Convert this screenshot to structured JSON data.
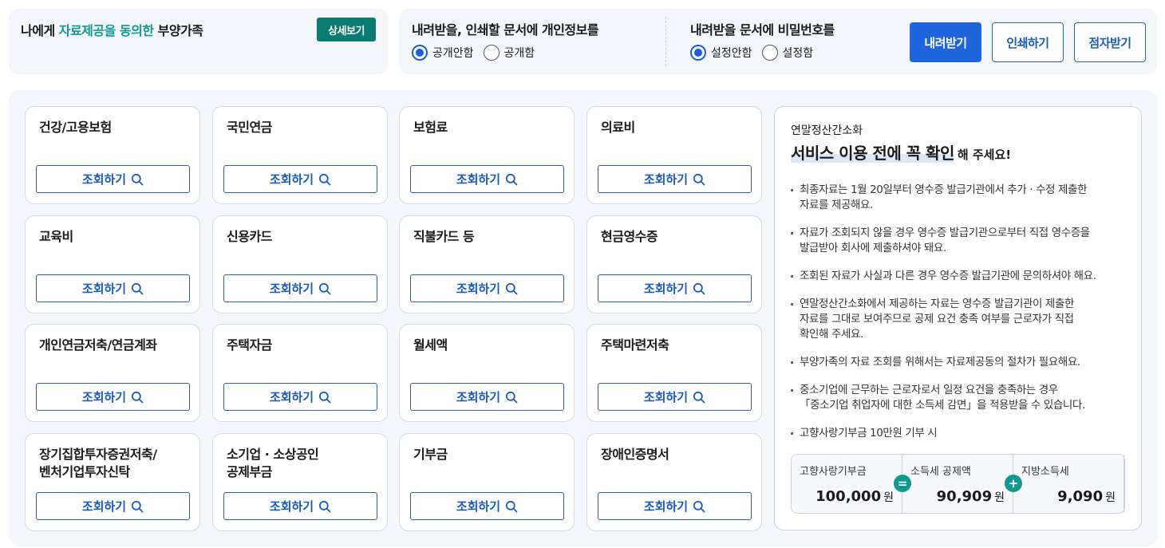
{
  "consent_panel": {
    "title_prefix": "나에게 ",
    "title_highlight": "자료제공을 동의한",
    "title_suffix": " 부양가족",
    "detail_button": "상세보기"
  },
  "options": {
    "personal_info": {
      "label": "내려받을, 인쇄할 문서에 개인정보를",
      "options": [
        "공개안함",
        "공개함"
      ],
      "selected": "공개안함"
    },
    "password": {
      "label": "내려받을 문서에 비밀번호를",
      "options": [
        "설정안함",
        "설정함"
      ],
      "selected": "설정안함"
    }
  },
  "actions": {
    "download": "내려받기",
    "print": "인쇄하기",
    "braille": "점자받기"
  },
  "query_label": "조회하기",
  "categories": [
    {
      "title": "건강/고용보험"
    },
    {
      "title": "국민연금"
    },
    {
      "title": "보험료"
    },
    {
      "title": "의료비"
    },
    {
      "title": "교육비"
    },
    {
      "title": "신용카드"
    },
    {
      "title": "직불카드 등"
    },
    {
      "title": "현금영수증"
    },
    {
      "title": "개인연금저축/연금계좌"
    },
    {
      "title": "주택자금"
    },
    {
      "title": "월세액"
    },
    {
      "title": "주택마련저축"
    },
    {
      "title_line1": "장기집합투자증권저축/",
      "title_line2": "벤처기업투자신탁"
    },
    {
      "title_line1": "소기업 · 소상공인",
      "title_line2": "공제부금"
    },
    {
      "title": "기부금"
    },
    {
      "title": "장애인증명서"
    }
  ],
  "info": {
    "subtitle": "연말정산간소화",
    "headline": "서비스 이용 전에 꼭 확인",
    "headline_tail": "해 주세요!",
    "notes": [
      {
        "line1": "최종자료는 1월 20일부터 영수증 발급기관에서 추가 · 수정 제출한",
        "line2": "자료를 제공해요."
      },
      {
        "line1": "자료가 조회되지 않을 경우 영수증 발급기관으로부터 직접 영수증을",
        "line2": "발급받아 회사에 제출하셔야 돼요."
      },
      {
        "line1": "조회된 자료가 사실과 다른 경우 영수증 발급기관에 문의하셔야 해요."
      },
      {
        "line1": "연말정산간소화에서 제공하는 자료는 영수증 발급기관이 제출한",
        "line2": "자료를 그대로 보여주므로 공제 요건 충족 여부를 근로자가 직접",
        "line3": "확인해 주세요."
      },
      {
        "line1": "부양가족의 자료 조회를 위해서는 자료제공동의 절차가 필요해요."
      },
      {
        "line1": "중소기업에 근무하는 근로자로서 일정 요건을 충족하는 경우",
        "line2": "「중소기업 취업자에 대한 소득세 감면」을 적용받을 수 있습니다."
      },
      {
        "line1": "고향사랑기부금 10만원 기부 시"
      }
    ],
    "calc": {
      "donation_label": "고향사랑기부금",
      "donation_value": "100,000",
      "tax_credit_label": "소득세 공제액",
      "tax_credit_value": "90,909",
      "local_tax_label": "지방소득세",
      "local_tax_value": "9,090",
      "unit": "원",
      "equals": "=",
      "plus": "+"
    }
  },
  "colors": {
    "accent_teal": "#12988e",
    "primary_blue": "#1e64dc",
    "panel_bg": "#f3f6fb"
  }
}
